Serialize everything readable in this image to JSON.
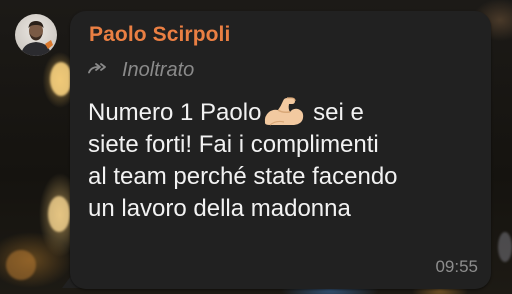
{
  "chat": {
    "sender_name": "Paolo Scirpoli",
    "forwarded_label": "Inoltrato",
    "message_lines": [
      "Numero 1 Paolo",
      " sei e",
      "siete forti! Fai i complimenti",
      "al team perché state facendo",
      "un lavoro della madonna"
    ],
    "emoji_name": "flexed-biceps-emoji",
    "timestamp": "09:55"
  },
  "icons": {
    "forward": "forward-arrow-icon",
    "avatar": "avatar-photo"
  },
  "colors": {
    "bubble_background": "#212121",
    "sender_name": "#ea7f43",
    "message_text": "#f2f2f2",
    "meta_text": "#8a8a8a"
  }
}
